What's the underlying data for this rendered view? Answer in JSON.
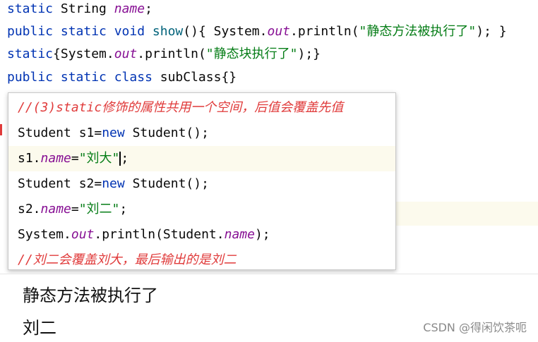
{
  "code": {
    "line1": {
      "kw": "static",
      "type": " String ",
      "field": "name",
      "end": ";"
    },
    "line2": {
      "kw": "public static void",
      "method": " show",
      "p1": "(){ System.",
      "out": "out",
      "p2": ".println(",
      "str": "\"静态方法被执行了\"",
      "end": "); }"
    },
    "line3": {
      "kw": "static",
      "p1": "{System.",
      "out": "out",
      "p2": ".println(",
      "str": "\"静态块执行了\"",
      "end": ");}"
    },
    "line4": {
      "kw": "public static class",
      "rest": " subClass{}"
    }
  },
  "popup": {
    "comment1": "//(3)static修饰的属性共用一个空间，后值会覆盖先值",
    "l1_a": "Student s1=",
    "l1_kw": "new",
    "l1_b": " Student();",
    "l2_a": "s1.",
    "l2_f": "name",
    "l2_eq": "=",
    "l2_str": "\"刘大\"",
    "l2_end": ";",
    "l3_a": "Student s2=",
    "l3_kw": "new",
    "l3_b": " Student();",
    "l4_a": "s2.",
    "l4_f": "name",
    "l4_eq": "=",
    "l4_str": "\"刘二\"",
    "l4_end": ";",
    "l5_a": "System.",
    "l5_out": "out",
    "l5_b": ".println(Student.",
    "l5_f": "name",
    "l5_end": ");",
    "comment2": "//刘二会覆盖刘大，最后输出的是刘二"
  },
  "output": {
    "line1": "静态方法被执行了",
    "line2": "刘二"
  },
  "watermark": "CSDN @得闲饮茶呃",
  "colors": {
    "keyword": "#0033b3",
    "field": "#871094",
    "string": "#067d17",
    "comment": "#e03b3b",
    "highlight": "#fcfaed"
  }
}
